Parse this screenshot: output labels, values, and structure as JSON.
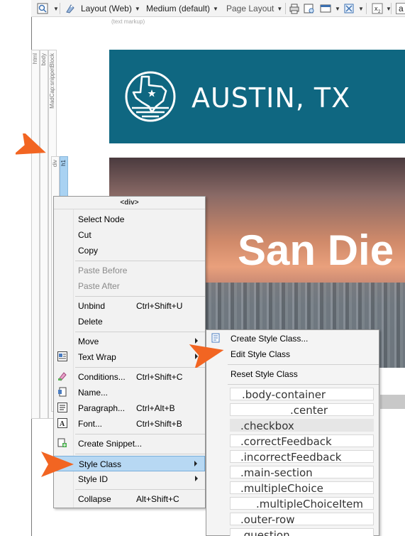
{
  "toolbar": {
    "layout": "Layout (Web)",
    "medium": "Medium (default)",
    "page_layout": "Page Layout",
    "a_label": "a"
  },
  "editor": {
    "markup_label": "(text markup)",
    "structure_bars": [
      "html",
      "body",
      "MadCap:snippetBlock",
      "div",
      "h1"
    ]
  },
  "content": {
    "header_title": "AUSTIN, TX",
    "hero_text": "San Die"
  },
  "context_menu": {
    "header": "<div>",
    "items": [
      {
        "label": "Select Node",
        "shortcut": ""
      },
      {
        "label": "Cut",
        "shortcut": ""
      },
      {
        "label": "Copy",
        "shortcut": ""
      },
      {
        "label": "Paste Before",
        "shortcut": ""
      },
      {
        "label": "Paste After",
        "shortcut": ""
      },
      {
        "label": "Unbind",
        "shortcut": "Ctrl+Shift+U"
      },
      {
        "label": "Delete",
        "shortcut": ""
      },
      {
        "label": "Move",
        "shortcut": ""
      },
      {
        "label": "Text Wrap",
        "shortcut": ""
      },
      {
        "label": "Conditions...",
        "shortcut": "Ctrl+Shift+C"
      },
      {
        "label": "Name...",
        "shortcut": ""
      },
      {
        "label": "Paragraph...",
        "shortcut": "Ctrl+Alt+B"
      },
      {
        "label": "Font...",
        "shortcut": "Ctrl+Shift+B"
      },
      {
        "label": "Create Snippet...",
        "shortcut": ""
      },
      {
        "label": "Style Class",
        "shortcut": ""
      },
      {
        "label": "Style ID",
        "shortcut": ""
      },
      {
        "label": "Collapse",
        "shortcut": "Alt+Shift+C"
      }
    ]
  },
  "submenu": {
    "items": [
      "Create Style Class...",
      "Edit Style Class",
      "Reset Style Class"
    ],
    "classes": [
      ".body-container",
      ".center",
      ".checkbox",
      ".correctFeedback",
      ".incorrectFeedback",
      ".main-section",
      ".multipleChoice",
      ".multipleChoiceItem",
      ".outer-row",
      ".question"
    ]
  },
  "colors": {
    "header_band": "#0f6781",
    "highlight": "#b7d8f3",
    "pointer": "#f26522"
  }
}
